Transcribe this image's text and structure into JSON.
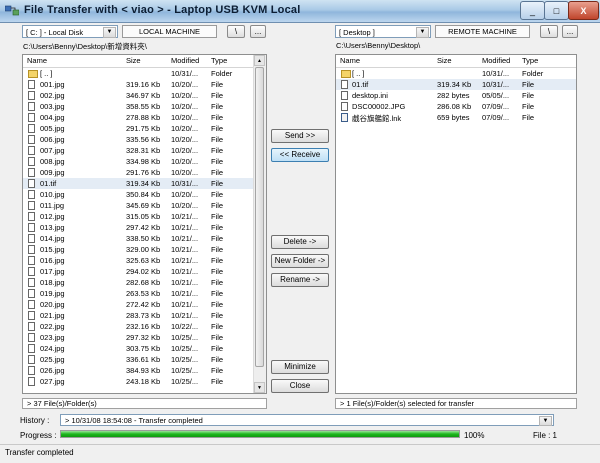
{
  "window": {
    "title": "File Transfer with < viao > -  Laptop USB KVM Local",
    "minimize_glyph": "_",
    "maximize_glyph": "□",
    "close_glyph": "X"
  },
  "local": {
    "drive": "[ C: ] - Local Disk",
    "machine": "LOCAL MACHINE",
    "root_btn": "\\",
    "browse_btn": "...",
    "path": "C:\\Users\\Benny\\Desktop\\新增資料夾\\",
    "headers": {
      "name": "Name",
      "size": "Size",
      "modified": "Modified",
      "type": "Type"
    },
    "rows": [
      {
        "icon": "folder",
        "name": "[ .. ]",
        "size": "",
        "modified": "10/31/...",
        "type": "Folder"
      },
      {
        "icon": "file",
        "name": "001.jpg",
        "size": "319.16 Kb",
        "modified": "10/20/...",
        "type": "File"
      },
      {
        "icon": "file",
        "name": "002.jpg",
        "size": "346.97 Kb",
        "modified": "10/20/...",
        "type": "File"
      },
      {
        "icon": "file",
        "name": "003.jpg",
        "size": "358.55 Kb",
        "modified": "10/20/...",
        "type": "File"
      },
      {
        "icon": "file",
        "name": "004.jpg",
        "size": "278.88 Kb",
        "modified": "10/20/...",
        "type": "File"
      },
      {
        "icon": "file",
        "name": "005.jpg",
        "size": "291.75 Kb",
        "modified": "10/20/...",
        "type": "File"
      },
      {
        "icon": "file",
        "name": "006.jpg",
        "size": "335.56 Kb",
        "modified": "10/20/...",
        "type": "File"
      },
      {
        "icon": "file",
        "name": "007.jpg",
        "size": "328.31 Kb",
        "modified": "10/20/...",
        "type": "File"
      },
      {
        "icon": "file",
        "name": "008.jpg",
        "size": "334.98 Kb",
        "modified": "10/20/...",
        "type": "File"
      },
      {
        "icon": "file",
        "name": "009.jpg",
        "size": "291.76 Kb",
        "modified": "10/20/...",
        "type": "File"
      },
      {
        "icon": "file",
        "name": "01.tif",
        "size": "319.34 Kb",
        "modified": "10/31/...",
        "type": "File",
        "selected": true
      },
      {
        "icon": "file",
        "name": "010.jpg",
        "size": "350.84 Kb",
        "modified": "10/20/...",
        "type": "File"
      },
      {
        "icon": "file",
        "name": "011.jpg",
        "size": "345.69 Kb",
        "modified": "10/20/...",
        "type": "File"
      },
      {
        "icon": "file",
        "name": "012.jpg",
        "size": "315.05 Kb",
        "modified": "10/21/...",
        "type": "File"
      },
      {
        "icon": "file",
        "name": "013.jpg",
        "size": "297.42 Kb",
        "modified": "10/21/...",
        "type": "File"
      },
      {
        "icon": "file",
        "name": "014.jpg",
        "size": "338.50 Kb",
        "modified": "10/21/...",
        "type": "File"
      },
      {
        "icon": "file",
        "name": "015.jpg",
        "size": "329.00 Kb",
        "modified": "10/21/...",
        "type": "File"
      },
      {
        "icon": "file",
        "name": "016.jpg",
        "size": "325.63 Kb",
        "modified": "10/21/...",
        "type": "File"
      },
      {
        "icon": "file",
        "name": "017.jpg",
        "size": "294.02 Kb",
        "modified": "10/21/...",
        "type": "File"
      },
      {
        "icon": "file",
        "name": "018.jpg",
        "size": "282.68 Kb",
        "modified": "10/21/...",
        "type": "File"
      },
      {
        "icon": "file",
        "name": "019.jpg",
        "size": "263.53 Kb",
        "modified": "10/21/...",
        "type": "File"
      },
      {
        "icon": "file",
        "name": "020.jpg",
        "size": "272.42 Kb",
        "modified": "10/21/...",
        "type": "File"
      },
      {
        "icon": "file",
        "name": "021.jpg",
        "size": "283.73 Kb",
        "modified": "10/21/...",
        "type": "File"
      },
      {
        "icon": "file",
        "name": "022.jpg",
        "size": "232.16 Kb",
        "modified": "10/22/...",
        "type": "File"
      },
      {
        "icon": "file",
        "name": "023.jpg",
        "size": "297.32 Kb",
        "modified": "10/25/...",
        "type": "File"
      },
      {
        "icon": "file",
        "name": "024.jpg",
        "size": "303.75 Kb",
        "modified": "10/25/...",
        "type": "File"
      },
      {
        "icon": "file",
        "name": "025.jpg",
        "size": "336.61 Kb",
        "modified": "10/25/...",
        "type": "File"
      },
      {
        "icon": "file",
        "name": "026.jpg",
        "size": "384.93 Kb",
        "modified": "10/25/...",
        "type": "File"
      },
      {
        "icon": "file",
        "name": "027.jpg",
        "size": "243.18 Kb",
        "modified": "10/25/...",
        "type": "File"
      }
    ],
    "status": "> 37 File(s)/Folder(s)"
  },
  "remote": {
    "drive": "[ Desktop ]",
    "machine": "REMOTE MACHINE",
    "root_btn": "\\",
    "browse_btn": "...",
    "path": "C:\\Users\\Benny\\Desktop\\",
    "headers": {
      "name": "Name",
      "size": "Size",
      "modified": "Modified",
      "type": "Type"
    },
    "rows": [
      {
        "icon": "folder",
        "name": "[ .. ]",
        "size": "",
        "modified": "10/31/...",
        "type": "Folder"
      },
      {
        "icon": "file",
        "name": "01.tif",
        "size": "319.34 Kb",
        "modified": "10/31/...",
        "type": "File",
        "selected": true
      },
      {
        "icon": "file",
        "name": "desktop.ini",
        "size": "282 bytes",
        "modified": "05/05/...",
        "type": "File"
      },
      {
        "icon": "file",
        "name": "DSC00002.JPG",
        "size": "286.08 Kb",
        "modified": "07/09/...",
        "type": "File"
      },
      {
        "icon": "link",
        "name": "戲谷旗艦館.lnk",
        "size": "659 bytes",
        "modified": "07/09/...",
        "type": "File"
      }
    ],
    "status": "> 1 File(s)/Folder(s) selected for transfer"
  },
  "actions": {
    "send": "Send >>",
    "receive": "<< Receive",
    "delete": "Delete ->",
    "new_folder": "New Folder ->",
    "rename": "Rename ->",
    "minimize": "Minimize",
    "close": "Close"
  },
  "history": {
    "label": "History :",
    "value": "> 10/31/08 18:54:08 - Transfer completed"
  },
  "progress": {
    "label": "Progress :",
    "percent_text": "100%",
    "fraction": 1.0,
    "file_label": "File : 1"
  },
  "statusbar": {
    "text": "Transfer completed"
  },
  "colors": {
    "progress_fill": "#1fb71f",
    "selection": "#e4ecf5"
  }
}
